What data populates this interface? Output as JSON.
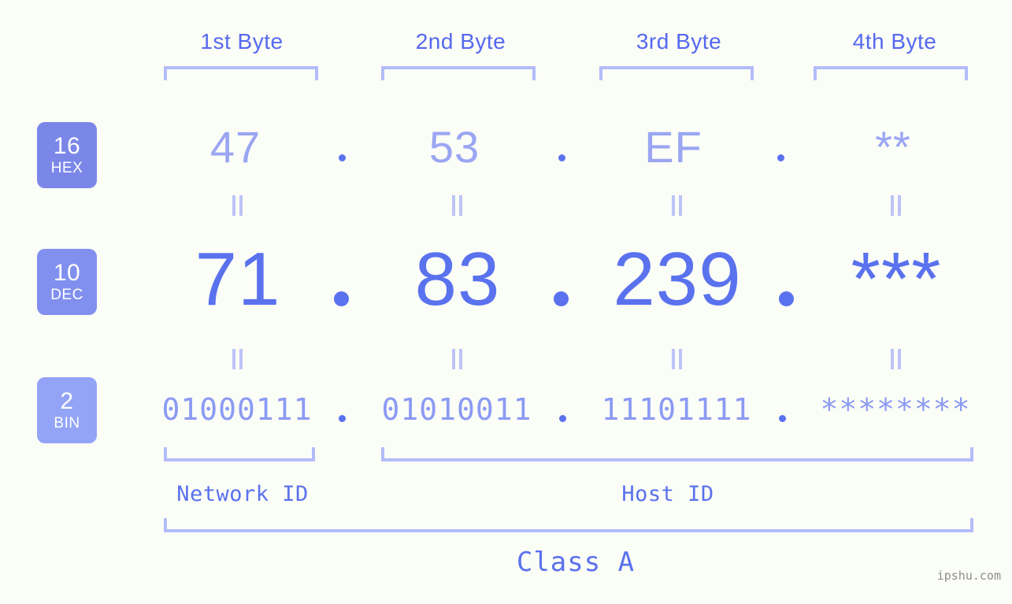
{
  "background_color": "#fbfdf7",
  "accent_colors": {
    "strong_blue": "#5a72ee",
    "mid_lavender": "#9aa6f2",
    "light_lavender": "#b3bcf9",
    "badge_hex": "#7b87e8",
    "badge_dec": "#8190ef",
    "badge_bin": "#93a4f6",
    "watermark_gray": "#8d8d8d"
  },
  "byte_headers": [
    {
      "label": "1st Byte"
    },
    {
      "label": "2nd Byte"
    },
    {
      "label": "3rd Byte"
    },
    {
      "label": "4th Byte"
    }
  ],
  "rows": [
    {
      "badge_number": "16",
      "badge_abbr": "HEX",
      "values": [
        "47",
        "53",
        "EF",
        "**"
      ]
    },
    {
      "badge_number": "10",
      "badge_abbr": "DEC",
      "values": [
        "71",
        "83",
        "239",
        "***"
      ]
    },
    {
      "badge_number": "2",
      "badge_abbr": "BIN",
      "values": [
        "01000111",
        "01010011",
        "11101111",
        "********"
      ]
    }
  ],
  "separator": ".",
  "equals_marker": "=",
  "sections": [
    {
      "label": "Network ID"
    },
    {
      "label": "Host ID"
    }
  ],
  "class_label": "Class A",
  "watermark": "ipshu.com"
}
